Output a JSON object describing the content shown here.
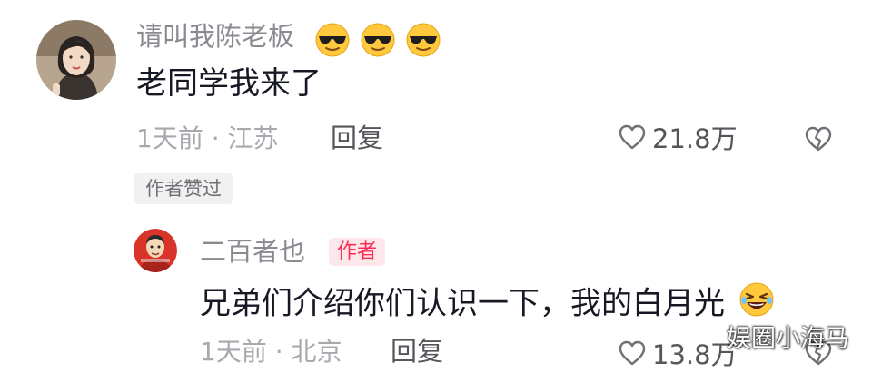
{
  "comment": {
    "username": "请叫我陈老板",
    "username_emojis": [
      "sunglasses-emoji",
      "sunglasses-emoji",
      "sunglasses-emoji"
    ],
    "text": "老同学我来了",
    "meta": "1天前 · 江苏",
    "reply_label": "回复",
    "like_count": "21.8万",
    "author_liked_badge": "作者赞过"
  },
  "reply": {
    "username": "二百者也",
    "author_badge": "作者",
    "text": "兄弟们介绍你们认识一下，我的白月光",
    "text_emoji": "laughing-emoji",
    "meta": "1天前 · 北京",
    "reply_label": "回复",
    "like_count": "13.8万"
  },
  "watermark": "娱圈小海马",
  "colors": {
    "text_primary": "#161823",
    "text_secondary": "#8a8b91",
    "text_meta": "#a8a9ae",
    "author_badge_bg": "#fde7ea",
    "author_badge_text": "#fe2c55",
    "badge_bg": "#f1f1f2"
  }
}
